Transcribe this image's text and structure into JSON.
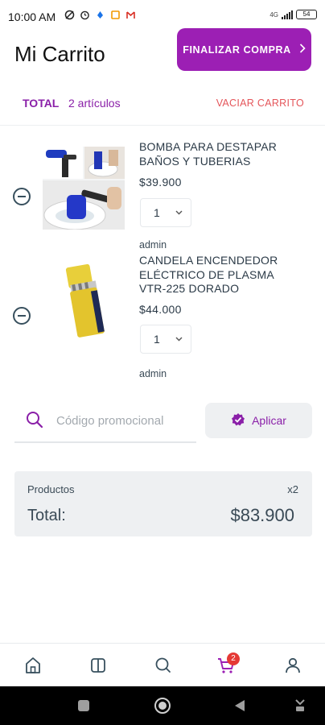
{
  "status_bar": {
    "time": "10:00 AM",
    "left_icons": [
      "data-saver-icon",
      "alarm-icon",
      "dot-icon",
      "square-app-icon",
      "gmail-icon"
    ],
    "network_label": "4G",
    "battery": "54"
  },
  "header": {
    "title": "Mi Carrito",
    "checkout_label": "FINALIZAR COMPRA",
    "checkout_color": "#9c1fb4"
  },
  "summary": {
    "total_label": "TOTAL",
    "item_count": "2 artículos",
    "empty_label": "VACIAR CARRITO",
    "accent_color": "#8a1fa8",
    "empty_color": "#e4555a"
  },
  "items": [
    {
      "name": "BOMBA PARA DESTAPAR BAÑOS Y TUBERIAS",
      "price": "$39.900",
      "quantity": "1",
      "author": "admin"
    },
    {
      "name": "CANDELA ENCENDEDOR ELÉCTRICO DE PLASMA VTR-225 DORADO",
      "price": "$44.000",
      "quantity": "1",
      "author": "admin"
    }
  ],
  "promo": {
    "placeholder": "Código promocional",
    "apply_label": "Aplicar"
  },
  "totals": {
    "products_label": "Productos",
    "products_qty": "x2",
    "total_label": "Total:",
    "total_value": "$83.900"
  },
  "bottom_nav": {
    "items": [
      "home-icon",
      "catalog-icon",
      "search-icon",
      "cart-icon",
      "profile-icon"
    ],
    "cart_badge": "2",
    "active": "cart-icon"
  }
}
